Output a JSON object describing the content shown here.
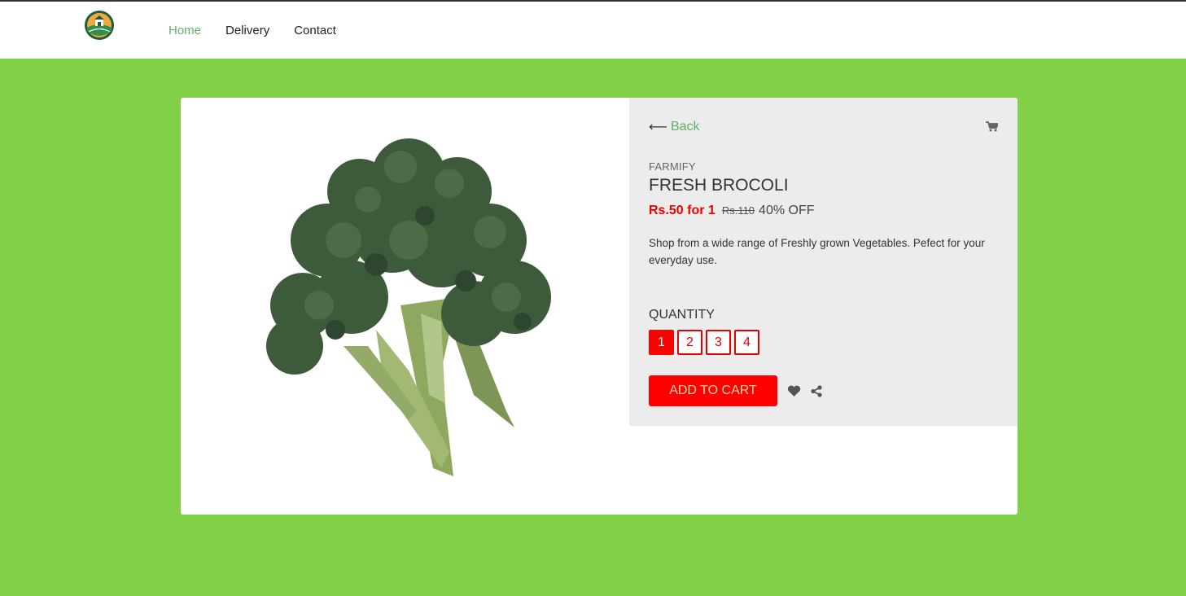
{
  "nav": {
    "items": [
      {
        "label": "Home",
        "active": true
      },
      {
        "label": "Delivery",
        "active": false
      },
      {
        "label": "Contact",
        "active": false
      }
    ]
  },
  "product": {
    "back_label": "Back",
    "brand": "FARMIFY",
    "title": "FRESH BROCOLI",
    "price": "Rs.50 for 1",
    "old_price": "Rs.110",
    "discount": "40% OFF",
    "description": "Shop from a wide range of Freshly grown Vegetables. Pefect for your everyday use.",
    "quantity_label": "QUANTITY",
    "quantities": [
      "1",
      "2",
      "3",
      "4"
    ],
    "selected_quantity": "1",
    "add_to_cart_label": "ADD TO CART"
  },
  "colors": {
    "page_background": "#82cf48",
    "accent_green": "#5fae6a",
    "price_red": "#ee0000",
    "button_red": "#ff0000"
  },
  "icons": [
    "logo-icon",
    "back-arrow-icon",
    "cart-icon",
    "heart-icon",
    "share-icon"
  ]
}
